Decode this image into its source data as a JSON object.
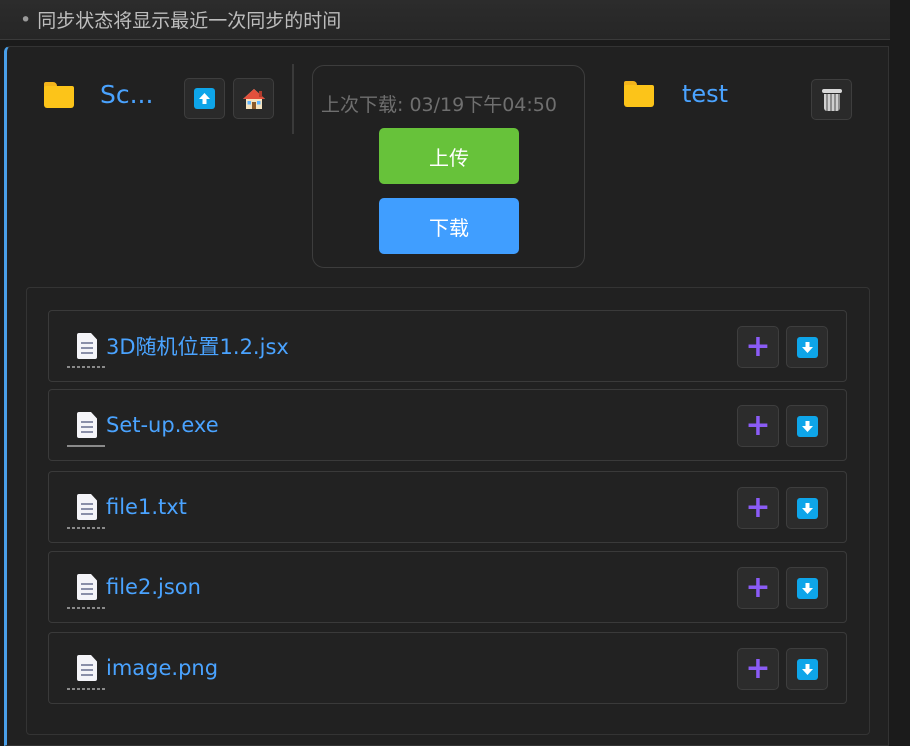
{
  "note": {
    "bullet": "•",
    "text": "同步状态将显示最近一次同步的时间"
  },
  "local": {
    "folder_name": "Sc..."
  },
  "sync": {
    "last_download": "上次下载: 03/19下午04:50",
    "upload_label": "上传",
    "download_label": "下载"
  },
  "remote": {
    "folder_name": "test"
  },
  "files": [
    {
      "name": "3D随机位置1.2.jsx"
    },
    {
      "name": "Set-up.exe"
    },
    {
      "name": "file1.txt"
    },
    {
      "name": "file2.json"
    },
    {
      "name": "image.png"
    }
  ],
  "icons": {
    "folder": "folder-icon",
    "up": "up-arrow-icon",
    "home": "home-icon",
    "trash": "trash-icon",
    "file": "document-icon",
    "plus": "plus-icon",
    "download": "down-arrow-icon"
  },
  "colors": {
    "accent_blue": "#409eff",
    "upload_green": "#67c23a",
    "link_blue": "#4aa3ff",
    "plus_purple": "#8b5cf6",
    "folder_yellow": "#fcc419"
  }
}
